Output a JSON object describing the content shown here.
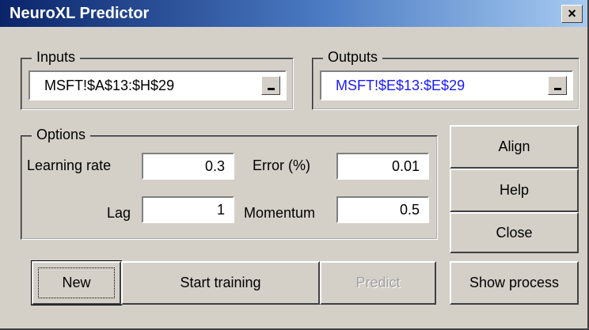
{
  "window": {
    "title": "NeuroXL Predictor",
    "close_label": "×"
  },
  "inputs": {
    "legend": "Inputs",
    "value": "MSFT!$A$13:$H$29"
  },
  "outputs": {
    "legend": "Outputs",
    "value": "MSFT!$E$13:$E$29",
    "value_color": "#1a1aff"
  },
  "options": {
    "legend": "Options",
    "learning_rate_label": "Learning rate",
    "learning_rate": "0.3",
    "error_label": "Error (%)",
    "error": "0.01",
    "lag_label": "Lag",
    "lag": "1",
    "momentum_label": "Momentum",
    "momentum": "0.5"
  },
  "buttons": {
    "align": "Align",
    "help": "Help",
    "close": "Close",
    "new": "New",
    "start_training": "Start training",
    "predict": "Predict",
    "show_process": "Show process"
  }
}
